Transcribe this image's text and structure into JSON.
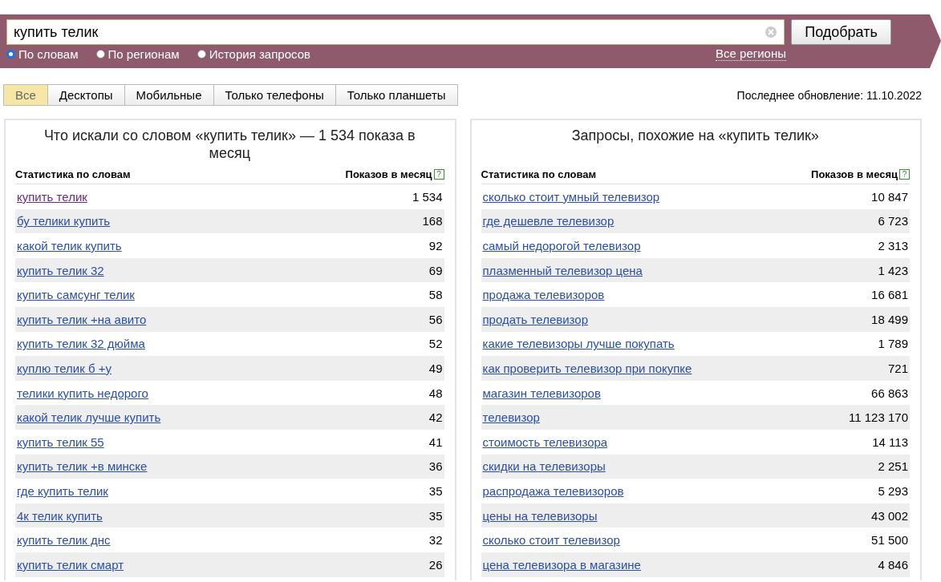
{
  "search": {
    "value": "купить телик",
    "button": "Подобрать"
  },
  "modes": [
    {
      "label": "По словам",
      "selected": true
    },
    {
      "label": "По регионам",
      "selected": false
    },
    {
      "label": "История запросов",
      "selected": false
    }
  ],
  "regions_link": "Все регионы",
  "tabs": [
    {
      "label": "Все",
      "selected": true
    },
    {
      "label": "Десктопы",
      "selected": false
    },
    {
      "label": "Мобильные",
      "selected": false
    },
    {
      "label": "Только телефоны",
      "selected": false
    },
    {
      "label": "Только планшеты",
      "selected": false
    }
  ],
  "last_update": "Последнее обновление: 11.10.2022",
  "panels": [
    {
      "title": "Что искали со словом «купить телик» — 1 534 показа в месяц",
      "col_phrase": "Статистика по словам",
      "col_count": "Показов в месяц",
      "help": "?",
      "rows": [
        {
          "phrase": "купить телик",
          "count": "1 534",
          "visited": true
        },
        {
          "phrase": "бу телики купить",
          "count": "168",
          "visited": false
        },
        {
          "phrase": "какой телик купить",
          "count": "92",
          "visited": false
        },
        {
          "phrase": "купить телик 32",
          "count": "69",
          "visited": false
        },
        {
          "phrase": "купить самсунг телик",
          "count": "58",
          "visited": false
        },
        {
          "phrase": "купить телик +на авито",
          "count": "56",
          "visited": false
        },
        {
          "phrase": "купить телик 32 дюйма",
          "count": "52",
          "visited": false
        },
        {
          "phrase": "куплю телик б +у",
          "count": "49",
          "visited": false
        },
        {
          "phrase": "телики купить недорого",
          "count": "48",
          "visited": false
        },
        {
          "phrase": "какой телик лучше купить",
          "count": "42",
          "visited": false
        },
        {
          "phrase": "купить телик 55",
          "count": "41",
          "visited": false
        },
        {
          "phrase": "купить телик +в минске",
          "count": "36",
          "visited": false
        },
        {
          "phrase": "где купить телик",
          "count": "35",
          "visited": false
        },
        {
          "phrase": "4к телик купить",
          "count": "35",
          "visited": false
        },
        {
          "phrase": "купить телик днс",
          "count": "32",
          "visited": false
        },
        {
          "phrase": "купить телик смарт",
          "count": "26",
          "visited": false
        }
      ]
    },
    {
      "title": "Запросы, похожие на «купить телик»",
      "col_phrase": "Статистика по словам",
      "col_count": "Показов в месяц",
      "help": "?",
      "rows": [
        {
          "phrase": "сколько стоит умный телевизор",
          "count": "10 847",
          "visited": false
        },
        {
          "phrase": "где дешевле телевизор",
          "count": "6 723",
          "visited": false
        },
        {
          "phrase": "самый недорогой телевизор",
          "count": "2 313",
          "visited": false
        },
        {
          "phrase": "плазменный телевизор цена",
          "count": "1 423",
          "visited": false
        },
        {
          "phrase": "продажа телевизоров",
          "count": "16 681",
          "visited": false
        },
        {
          "phrase": "продать телевизор",
          "count": "18 499",
          "visited": false
        },
        {
          "phrase": "какие телевизоры лучше покупать",
          "count": "1 789",
          "visited": false
        },
        {
          "phrase": "как проверить телевизор при покупке",
          "count": "721",
          "visited": false
        },
        {
          "phrase": "магазин телевизоров",
          "count": "66 863",
          "visited": false
        },
        {
          "phrase": "телевизор",
          "count": "11 123 170",
          "visited": false
        },
        {
          "phrase": "стоимость телевизора",
          "count": "14 113",
          "visited": false
        },
        {
          "phrase": "скидки на телевизоры",
          "count": "2 251",
          "visited": false
        },
        {
          "phrase": "распродажа телевизоров",
          "count": "5 293",
          "visited": false
        },
        {
          "phrase": "цены на телевизоры",
          "count": "43 002",
          "visited": false
        },
        {
          "phrase": "сколько стоит телевизор",
          "count": "51 500",
          "visited": false
        },
        {
          "phrase": "цена телевизора в магазине",
          "count": "4 846",
          "visited": false
        }
      ]
    }
  ]
}
